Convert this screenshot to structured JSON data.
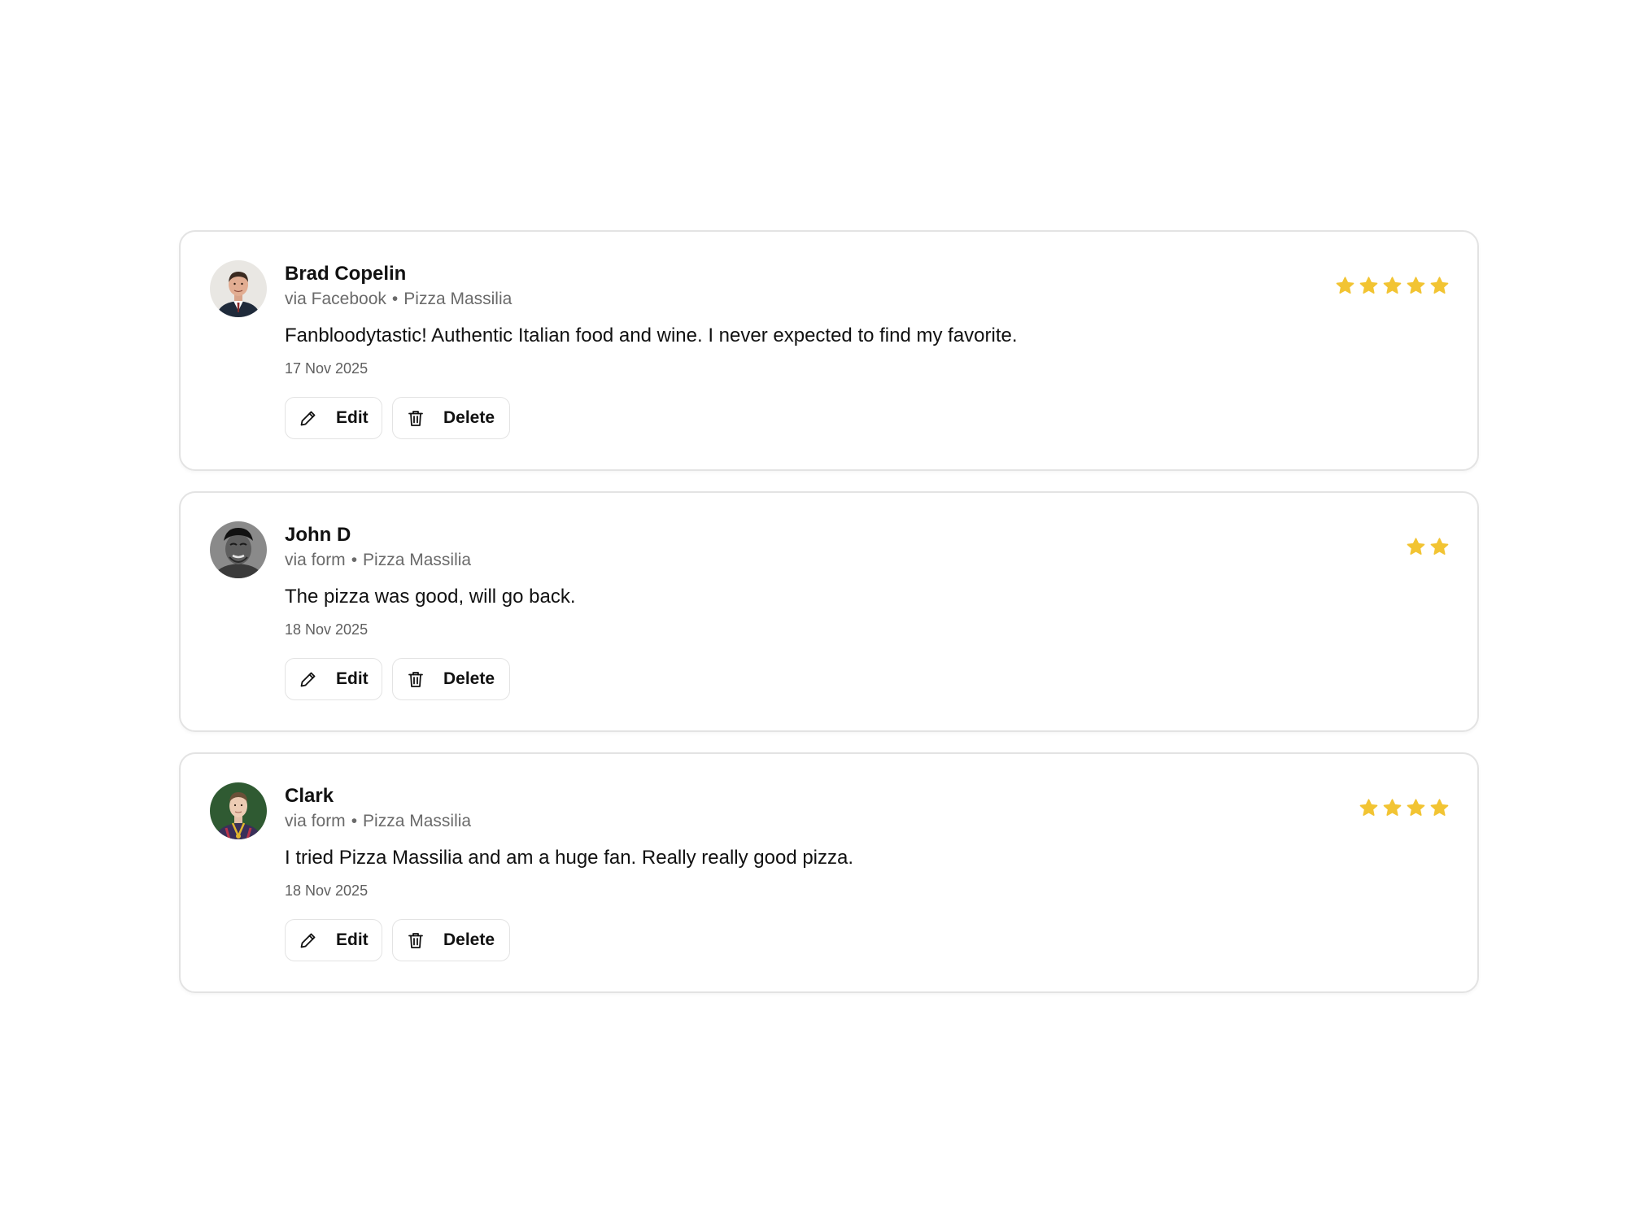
{
  "colors": {
    "star": "#f2c433",
    "border": "#e3e3e3",
    "meta_text": "#6a6a6a"
  },
  "icons": {
    "edit": "pencil-icon",
    "delete": "trash-icon",
    "rating": "star-icon"
  },
  "reviews": [
    {
      "name": "Brad Copelin",
      "source": "via Facebook",
      "separator": "•",
      "location": "Pizza Massilia",
      "text": "Fanbloodytastic! Authentic Italian food and wine. I never expected to find my favorite.",
      "date": "17 Nov 2025",
      "rating": 5,
      "edit_label": "Edit",
      "delete_label": "Delete"
    },
    {
      "name": "John D",
      "source": "via form",
      "separator": "•",
      "location": "Pizza Massilia",
      "text": "The pizza was good, will go back.",
      "date": "18 Nov 2025",
      "rating": 2,
      "edit_label": "Edit",
      "delete_label": "Delete"
    },
    {
      "name": "Clark",
      "source": "via form",
      "separator": "•",
      "location": "Pizza Massilia",
      "text": "I tried Pizza Massilia and am a huge fan. Really really good pizza.",
      "date": "18 Nov 2025",
      "rating": 4,
      "edit_label": "Edit",
      "delete_label": "Delete"
    }
  ]
}
